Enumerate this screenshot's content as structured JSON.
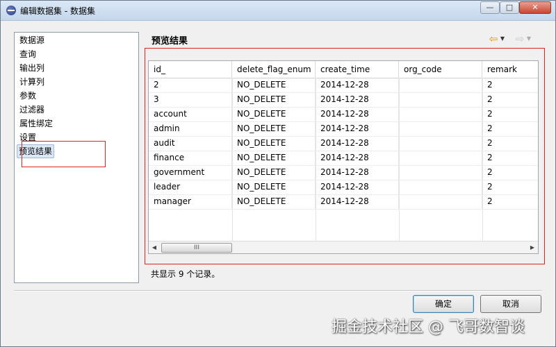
{
  "window": {
    "title": "编辑数据集 - 数据集",
    "min_label": "—",
    "max_label": "□",
    "close_label": "✕"
  },
  "nav": {
    "items": [
      {
        "label": "数据源"
      },
      {
        "label": "查询"
      },
      {
        "label": "输出列"
      },
      {
        "label": "计算列"
      },
      {
        "label": "参数"
      },
      {
        "label": "过滤器"
      },
      {
        "label": "属性绑定"
      },
      {
        "label": "设置"
      },
      {
        "label": "预览结果",
        "selected": true
      }
    ]
  },
  "page": {
    "title": "预览结果"
  },
  "icons": {
    "back": "back-arrow-icon",
    "forward": "forward-arrow-icon"
  },
  "grid": {
    "columns": [
      "id_",
      "delete_flag_enum",
      "create_time",
      "org_code",
      "remark"
    ],
    "rows": [
      [
        "2",
        "NO_DELETE",
        "2014-12-28",
        "",
        "2"
      ],
      [
        "3",
        "NO_DELETE",
        "2014-12-28",
        "",
        "2"
      ],
      [
        "account",
        "NO_DELETE",
        "2014-12-28",
        "",
        "2"
      ],
      [
        "admin",
        "NO_DELETE",
        "2014-12-28",
        "",
        "2"
      ],
      [
        "audit",
        "NO_DELETE",
        "2014-12-28",
        "",
        "2"
      ],
      [
        "finance",
        "NO_DELETE",
        "2014-12-28",
        "",
        "2"
      ],
      [
        "government",
        "NO_DELETE",
        "2014-12-28",
        "",
        "2"
      ],
      [
        "leader",
        "NO_DELETE",
        "2014-12-28",
        "",
        "2"
      ],
      [
        "manager",
        "NO_DELETE",
        "2014-12-28",
        "",
        "2"
      ]
    ],
    "scroll_thumb_label": "III"
  },
  "status": {
    "record_count": "共显示 9 个记录。"
  },
  "buttons": {
    "ok": "确定",
    "cancel": "取消"
  },
  "watermark": "掘金技术社区 @ 飞哥数智谈",
  "colors": {
    "highlight_border": "#dd2222",
    "selected_bg": "#dbe8f7"
  }
}
